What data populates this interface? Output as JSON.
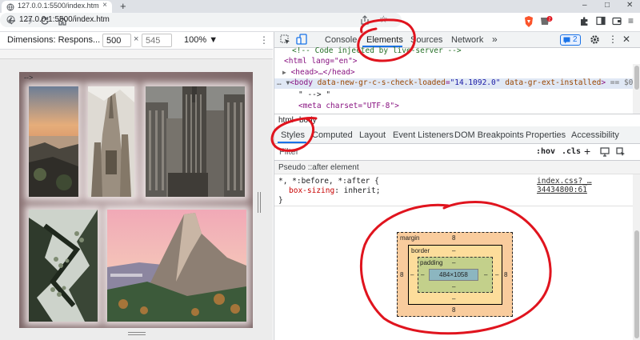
{
  "browser": {
    "tab_title": "127.0.0.1:5500/index.htm",
    "tab_close": "×",
    "new_tab": "+",
    "url": "127.0.0.1:5500/index.htm",
    "win_min": "–",
    "win_max": "□",
    "win_close": "✕",
    "extension_badge": "2"
  },
  "device_toolbar": {
    "dimensions_label": "Dimensions: Respons... ▼",
    "width": "500",
    "times": "×",
    "height_placeholder": "545",
    "zoom": "100% ▼",
    "menu": "⋮"
  },
  "page_preview": {
    "stray_text": "-->"
  },
  "devtools": {
    "tabs": [
      "Console",
      "Elements",
      "Sources",
      "Network"
    ],
    "more_tabs": "»",
    "issues_badge": "2",
    "elements": {
      "comment_line": "<!-- Code injected by live-server -->",
      "html_open": "<html lang=\"en\">",
      "head_collapsed": "<head>…</head>",
      "body_tag": "body",
      "body_attr1_name": "data-new-gr-c-s-check-loaded",
      "body_attr1_value": "\"14.1092.0\"",
      "body_attr2_name": "data-gr-ext-installed",
      "body_suffix": "== $0",
      "text_node": "\" --> \"",
      "meta_tag": "<meta charset=\"UTF-8\">"
    },
    "breadcrumbs": [
      "html",
      "body"
    ],
    "subtabs": [
      "Styles",
      "Computed",
      "Layout",
      "Event Listeners",
      "DOM Breakpoints",
      "Properties",
      "Accessibility"
    ],
    "filter_placeholder": "Filter",
    "hov": ":hov",
    "cls": ".cls",
    "add_rule": "+",
    "pseudo_header": "Pseudo ::after element",
    "rule": {
      "selector": "*, *:before, *:after {",
      "property": "box-sizing",
      "value": "inherit;",
      "close": "}",
      "source": "index.css?_…34434800:61"
    },
    "box_model": {
      "margin_label": "margin",
      "margin_top": "8",
      "margin_left": "8",
      "margin_right": "8",
      "margin_bottom": "8",
      "border_label": "border",
      "border_top": "–",
      "border_left": "–",
      "border_right": "–",
      "border_bottom": "–",
      "padding_label": "padding",
      "padding_top": "–",
      "padding_left": "–",
      "padding_right": "–",
      "padding_bottom": "–",
      "content": "484×1058"
    }
  },
  "colors": {
    "annotation_red": "#e0141e",
    "devtools_accent": "#1a73e8",
    "margin": "#f9cc9d",
    "border": "#fddd9b",
    "padding": "#c3d08b",
    "content": "#8cb6c0"
  }
}
